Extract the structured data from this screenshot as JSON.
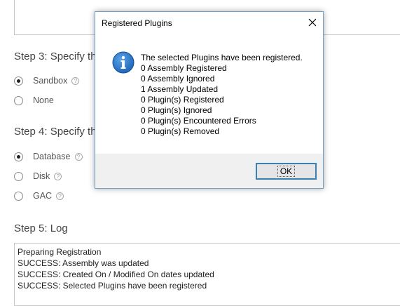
{
  "steps": {
    "step3": {
      "title": "Step 3: Specify th",
      "options": [
        {
          "label": "Sandbox",
          "checked": true
        },
        {
          "label": "None",
          "checked": false
        }
      ]
    },
    "step4": {
      "title": "Step 4: Specify th",
      "options": [
        {
          "label": "Database",
          "checked": true
        },
        {
          "label": "Disk",
          "checked": false
        },
        {
          "label": "GAC",
          "checked": false
        }
      ]
    },
    "step5": {
      "title": "Step 5: Log",
      "log": [
        "Preparing Registration",
        "SUCCESS: Assembly was updated",
        "SUCCESS: Created On / Modified On dates updated",
        "SUCCESS: Selected Plugins have been registered"
      ]
    }
  },
  "help_glyph": "?",
  "dialog": {
    "title": "Registered Plugins",
    "icon": "info-icon",
    "lines": [
      "The selected Plugins have been registered.",
      "0 Assembly Registered",
      "0 Assembly Ignored",
      "1 Assembly Updated",
      "0 Plugin(s) Registered",
      "0 Plugin(s) Ignored",
      "0 Plugin(s) Encountered Errors",
      "0 Plugin(s) Removed"
    ],
    "ok_label": "OK"
  },
  "colors": {
    "dialog_border": "#6f9ec8",
    "info_blue": "#1c63b4",
    "ok_border": "#3c7fb1"
  }
}
